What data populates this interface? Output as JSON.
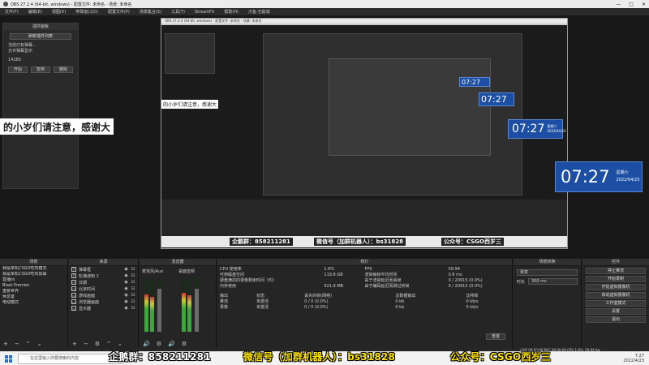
{
  "window": {
    "title": "OBS 27.2.4 (64-bit, windows) - 配置文件: 未命名 - 场景: 未命名",
    "minimize": "—",
    "maximize": "□",
    "close": "✕"
  },
  "menu": [
    "文件(F)",
    "编辑(E)",
    "视图(V)",
    "停靠窗口(D)",
    "配置文件(P)",
    "场景集合(S)",
    "工具(T)",
    "StreamFX",
    "帮助(H)",
    "爪鱼·无敌城"
  ],
  "plugin": {
    "header": "插件面板",
    "top_button": "刷新插件列表",
    "text_line1": "当前已有弹幕...",
    "text_line2": "允许弹幕显示",
    "text_line3": "14280",
    "btn_start": "开始",
    "btn_pause": "暂停",
    "btn_delete": "删除"
  },
  "overlay_text": "的小岁们请注意，感谢大",
  "nested_overlay_text": "的小岁们请注意，感谢大",
  "clocks": [
    {
      "time": "07:27",
      "day": "星期六",
      "date": "2022/04/23"
    },
    {
      "time": "07:27",
      "day": "星期六",
      "date": "2022/04/23"
    },
    {
      "time": "07:27",
      "day": "星期六",
      "date": "2022/04/23"
    },
    {
      "time": "07:27",
      "day": "星期六",
      "date": "2022/04/23"
    }
  ],
  "nested": {
    "title": "OBS 27.2.4 (64-bit, windows) - 配置文件: 未命名 - 场景: 未命名",
    "ad_texts": [
      "企鹅群：858211281",
      "微信号（加群机器人）：bs31828",
      "公众号：CSGO西岁三"
    ],
    "source_footer": "来自屏幕"
  },
  "docks": {
    "scenes": {
      "title": "场景",
      "items": [
        "我是单机CSGO吃鸡模式",
        "我是单机CSGO吃鸡屏幕",
        "直播间",
        "Blast Premier",
        "重要世界",
        "休息室",
        "电动模式"
      ]
    },
    "sources": {
      "title": "来源",
      "items": [
        {
          "icon": "T",
          "label": "弹幕框"
        },
        {
          "icon": "T",
          "label": "轮播通知 2"
        },
        {
          "icon": "◷",
          "label": "日期"
        },
        {
          "icon": "◷",
          "label": "北京时间"
        },
        {
          "icon": "▭",
          "label": "游戏画面"
        },
        {
          "icon": "▭",
          "label": "浏览器画面"
        },
        {
          "icon": "▭",
          "label": "显示器"
        }
      ]
    },
    "mixer": {
      "title": "混音器",
      "ch1": "麦克风/Aux",
      "ch2": "桌面音频"
    },
    "stats": {
      "title": "统计",
      "rows": [
        [
          "CPU 使用率",
          "1.6%",
          "FPS",
          "59.94"
        ],
        [
          "可用磁盘空间",
          "119.8 GB",
          "渲染每帧平均时间",
          "0.6 ms"
        ],
        [
          "硬盘满前的录像剩余时间（约）",
          "",
          "由于渲染延迟而丢帧",
          "0 / 20915 (0.0%)"
        ],
        [
          "内存使用",
          "921.9 MB",
          "由于编码延迟而跳过的帧",
          "0 / 20915 (0.0%)"
        ]
      ],
      "output_header": [
        "输出",
        "状态",
        "丢失的帧(网络)",
        "总数据输出",
        "比特率"
      ],
      "output_rows": [
        [
          "推流",
          "未激活",
          "0 / 0 (0.0%)",
          "0 kb",
          "0 kb/s"
        ],
        [
          "录像",
          "未激活",
          "0 / 0 (0.0%)",
          "0 kb",
          "0 kb/s"
        ]
      ],
      "reset": "重置"
    },
    "transitions": {
      "title": "场景转换",
      "type": "渐变",
      "duration_label": "时长",
      "duration": "300 ms"
    },
    "controls": {
      "title": "控件",
      "buttons": [
        "停止推流",
        "开始录制",
        "开始虚拟摄像机",
        "启动虚拟摄像机",
        "工作室模式",
        "设置",
        "退出"
      ]
    }
  },
  "status": {
    "text": "LIVE 00:00:00  REC 00:00:00  CPU 1.6%, 59.94 fps"
  },
  "taskbar": {
    "search_placeholder": "在这里输入你要搜索的内容",
    "time": "7:27",
    "date": "2022/4/23"
  },
  "banners": [
    "企鹅群：858211281",
    "微信号（加群机器人）：bs31828",
    "公众号：CSGO西岁三"
  ]
}
